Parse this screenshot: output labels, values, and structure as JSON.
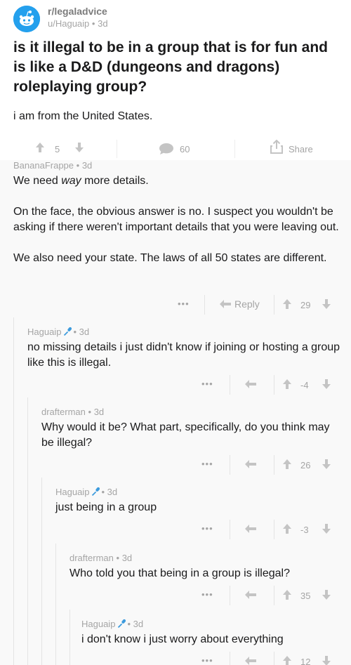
{
  "post": {
    "subreddit": "r/legaladvice",
    "author": "u/Haguaip",
    "age": "3d",
    "title": "is it illegal to be in a group that is for fun and is like a D&D (dungeons and dragons) roleplaying group?",
    "body": "i am from the United States.",
    "score": "5",
    "comment_count": "60",
    "share_label": "Share"
  },
  "comments": [
    {
      "author": "BananaFrappe",
      "age": "3d",
      "body_parts": {
        "p1_pre": "We need ",
        "p1_em": "way",
        "p1_post": " more details.",
        "p2": "On the face, the obvious answer is no. I suspect you wouldn't be asking if there weren't important details that you were leaving out.",
        "p3": "We also need your state. The laws of all 50 states are different."
      },
      "more": "•••",
      "reply_label": "Reply",
      "score": "29"
    },
    {
      "author": "Haguaip",
      "age": "3d",
      "body": "no missing details i just didn't know if joining or hosting a group like this is illegal.",
      "more": "•••",
      "score": "-4"
    },
    {
      "author": "drafterman",
      "age": "3d",
      "body": "Why would it be? What part, specifically, do you think may be illegal?",
      "more": "•••",
      "score": "26"
    },
    {
      "author": "Haguaip",
      "age": "3d",
      "body": "just being in a group",
      "more": "•••",
      "score": "-3"
    },
    {
      "author": "drafterman",
      "age": "3d",
      "body": "Who told you that being in a group is illegal?",
      "more": "•••",
      "score": "35"
    },
    {
      "author": "Haguaip",
      "age": "3d",
      "body": "i don't know i just worry about everything",
      "more": "•••",
      "score": "12"
    }
  ],
  "meta_separator": "•",
  "colors": {
    "reddit_blue": "#24a0ed",
    "op_mic_blue": "#3d9bdd",
    "muted_text": "#a5a5a5",
    "body_text": "#1a1a1b",
    "comment_bg": "#f9f9f9"
  },
  "icons": {
    "subreddit": "reddit-snoo-icon",
    "upvote": "arrow-up-icon",
    "downvote": "arrow-down-icon",
    "comments": "speech-bubble-icon",
    "share": "share-icon",
    "reply": "reply-arrow-icon",
    "op_badge": "microphone-icon"
  }
}
